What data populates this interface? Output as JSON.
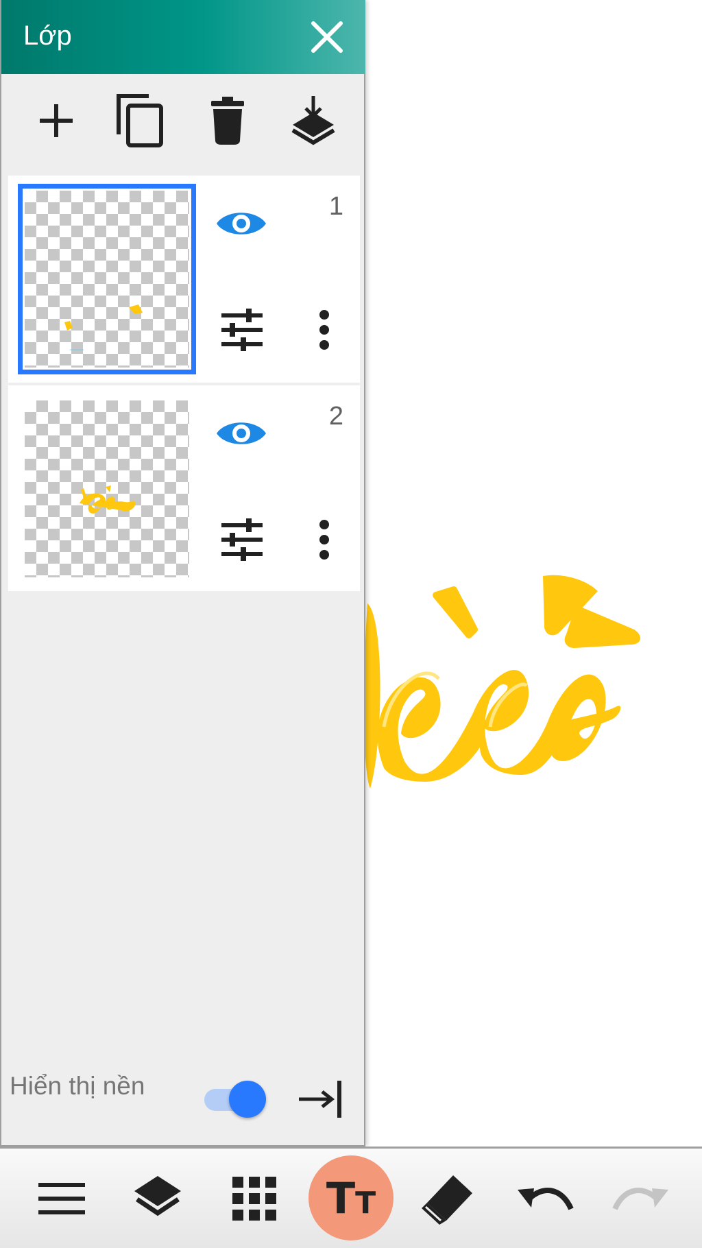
{
  "panel": {
    "title": "Lớp",
    "toolbar": [
      {
        "icon": "add-layer-icon"
      },
      {
        "icon": "duplicate-layer-icon"
      },
      {
        "icon": "delete-layer-icon"
      },
      {
        "icon": "merge-down-icon"
      }
    ],
    "layers": [
      {
        "number": "1",
        "selected": true,
        "visible": true
      },
      {
        "number": "2",
        "selected": false,
        "visible": true
      }
    ],
    "background_label": "Hiển thị nền",
    "background_visible": true
  },
  "bottom_bar": {
    "items": [
      {
        "icon": "menu-icon"
      },
      {
        "icon": "layers-icon"
      },
      {
        "icon": "grid-icon"
      },
      {
        "icon": "text-tool-icon",
        "label": "TT",
        "active": true
      },
      {
        "icon": "eraser-icon"
      },
      {
        "icon": "undo-icon"
      },
      {
        "icon": "redo-icon",
        "enabled": false
      }
    ]
  },
  "colors": {
    "header": "#009688",
    "accent": "#2979ff",
    "eye": "#1e88e5",
    "artwork": "#ffc80f",
    "text_tool_bg": "#f4987a"
  }
}
